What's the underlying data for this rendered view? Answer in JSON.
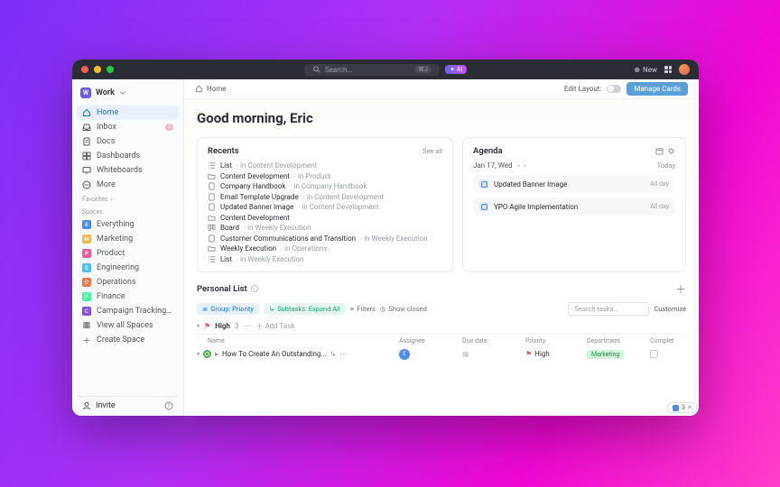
{
  "titlebar": {
    "search_placeholder": "Search...",
    "search_shortcut": "⌘J",
    "ai_label": "AI",
    "new_label": "New"
  },
  "sidebar": {
    "workspace": {
      "initial": "W",
      "name": "Work"
    },
    "nav": [
      {
        "icon": "home",
        "label": "Home",
        "active": true
      },
      {
        "icon": "inbox",
        "label": "Inbox",
        "badge": "3"
      },
      {
        "icon": "doc",
        "label": "Docs"
      },
      {
        "icon": "dash",
        "label": "Dashboards"
      },
      {
        "icon": "wb",
        "label": "Whiteboards"
      },
      {
        "icon": "more",
        "label": "More"
      }
    ],
    "favorites_label": "Favorites",
    "spaces_label": "Spaces",
    "spaces": [
      {
        "initial": "E",
        "color": "#4a8bf5",
        "label": "Everything"
      },
      {
        "initial": "M",
        "color": "#f5b74a",
        "label": "Marketing"
      },
      {
        "initial": "P",
        "color": "#e85d9d",
        "label": "Product"
      },
      {
        "initial": "E",
        "color": "#4ac0f5",
        "label": "Engineering"
      },
      {
        "initial": "O",
        "color": "#f5724a",
        "label": "Operations"
      },
      {
        "initial": "F",
        "color": "#4af5a0",
        "label": "Finance"
      },
      {
        "initial": "C",
        "color": "#8a4af5",
        "label": "Campaign Tracking Template"
      }
    ],
    "view_all": "View all Spaces",
    "create": "Create Space",
    "invite": "Invite"
  },
  "topbar": {
    "home": "Home",
    "edit_layout": "Edit Layout:",
    "manage": "Manage Cards"
  },
  "greeting": "Good morning, Eric",
  "recents": {
    "title": "Recents",
    "see_all": "See all",
    "items": [
      {
        "type": "list",
        "title": "List",
        "loc": "in Content Development"
      },
      {
        "type": "folder",
        "title": "Content Development",
        "loc": "in Product"
      },
      {
        "type": "doc",
        "title": "Company Handbook",
        "loc": "in Company Handbook"
      },
      {
        "type": "doc",
        "title": "Email Template Upgrade",
        "loc": "in Content Development"
      },
      {
        "type": "doc",
        "title": "Updated Banner Image",
        "loc": "in Content Development"
      },
      {
        "type": "folder",
        "title": "Content Development",
        "loc": ""
      },
      {
        "type": "board",
        "title": "Board",
        "loc": "in Weekly Execution"
      },
      {
        "type": "doc",
        "title": "Customer Communications and Transition",
        "loc": "in Weekly Execution"
      },
      {
        "type": "folder",
        "title": "Weekly Execution",
        "loc": "in Operations"
      },
      {
        "type": "list",
        "title": "List",
        "loc": "in Weekly Execution"
      }
    ]
  },
  "agenda": {
    "title": "Agenda",
    "date": "Jan 17, Wed",
    "today": "Today",
    "items": [
      {
        "title": "Updated Banner Image",
        "when": "All day"
      },
      {
        "title": "YPO Agile Implementation",
        "when": "All day"
      }
    ]
  },
  "personal": {
    "title": "Personal List",
    "pills": {
      "group": "Group: Priority",
      "subtasks": "Subtasks: Expand All"
    },
    "filters": "Filters",
    "closed": "Show closed",
    "search": "Search tasks...",
    "customize": "Customize",
    "group_name": "High",
    "group_count": "3",
    "addtask": "Add Task",
    "cols": {
      "name": "Name",
      "assignee": "Assignee",
      "due": "Due date",
      "priority": "Priority",
      "dept": "Department",
      "complete": "Complet"
    },
    "tasks": [
      {
        "title": "How To Create An Outstanding...",
        "assignee": "E",
        "priority": "High",
        "dept": "Marketing"
      }
    ]
  },
  "pager": "3"
}
